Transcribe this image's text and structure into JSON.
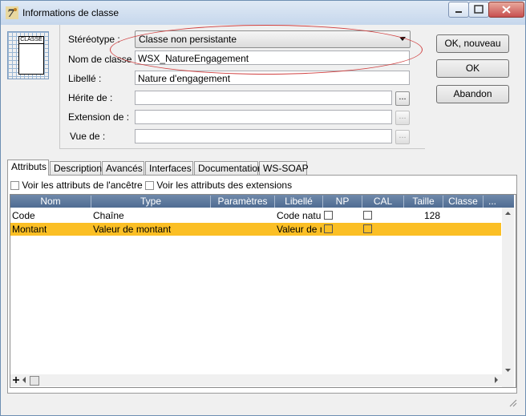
{
  "window": {
    "title": "Informations de classe",
    "icon": "app-icon"
  },
  "classicon": {
    "label": "CLASSE"
  },
  "form": {
    "stereotype_label": "Stéréotype :",
    "stereotype_value": "Classe non persistante",
    "nom_label": "Nom de classe :",
    "nom_value": "WSX_NatureEngagement",
    "libelle_label": "Libellé :",
    "libelle_value": "Nature d'engagement",
    "herite_label": "Hérite de :",
    "extension_label": "Extension de :",
    "vue_label": "Vue de :",
    "ellipsis": "..."
  },
  "buttons": {
    "ok_nouveau": "OK, nouveau",
    "ok": "OK",
    "abandon": "Abandon"
  },
  "tabs": [
    "Attributs",
    "Description",
    "Avancés",
    "Interfaces",
    "Documentation",
    "WS-SOAP"
  ],
  "options": {
    "ancetre": "Voir les attributs de l'ancêtre",
    "extensions": "Voir les attributs des extensions"
  },
  "table": {
    "headers": [
      "Nom",
      "Type",
      "Paramètres",
      "Libellé",
      "NP",
      "CAL",
      "Taille",
      "Classe",
      "..."
    ],
    "rows": [
      {
        "nom": "Code",
        "type": "Chaîne",
        "parametres": "",
        "libelle": "Code natur",
        "taille": "128",
        "classe": ""
      },
      {
        "nom": "Montant",
        "type": "Valeur de montant",
        "parametres": "",
        "libelle": "Valeur de m",
        "taille": "",
        "classe": ""
      }
    ],
    "selected_row_color": "#fbbf25",
    "header_color": "#587596"
  },
  "colors": {
    "highlight_ellipse": "#d04040"
  }
}
